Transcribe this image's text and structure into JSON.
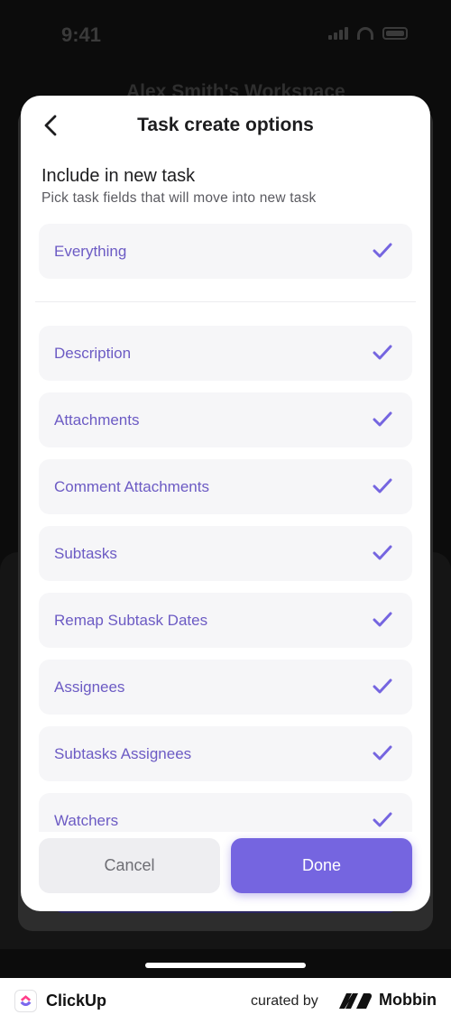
{
  "status": {
    "time": "9:41"
  },
  "background": {
    "workspace_title": "Alex Smith's Workspace"
  },
  "modal": {
    "title": "Task create options",
    "section_title": "Include in new task",
    "section_subtitle": "Pick task fields that will move into new task",
    "everything": {
      "label": "Everything",
      "checked": true
    },
    "options": [
      {
        "label": "Description",
        "checked": true
      },
      {
        "label": "Attachments",
        "checked": true
      },
      {
        "label": "Comment Attachments",
        "checked": true
      },
      {
        "label": "Subtasks",
        "checked": true
      },
      {
        "label": "Remap Subtask Dates",
        "checked": true
      },
      {
        "label": "Assignees",
        "checked": true
      },
      {
        "label": "Subtasks Assignees",
        "checked": true
      },
      {
        "label": "Watchers",
        "checked": true
      }
    ],
    "cancel_label": "Cancel",
    "done_label": "Done"
  },
  "footer": {
    "app_name": "ClickUp",
    "curated_by": "curated by",
    "brand": "Mobbin"
  },
  "colors": {
    "accent": "#7565e0",
    "option_text": "#6c5bc4",
    "option_bg": "#f6f6f8"
  },
  "icons": {
    "back": "chevron-left-icon",
    "check": "checkmark-icon"
  }
}
